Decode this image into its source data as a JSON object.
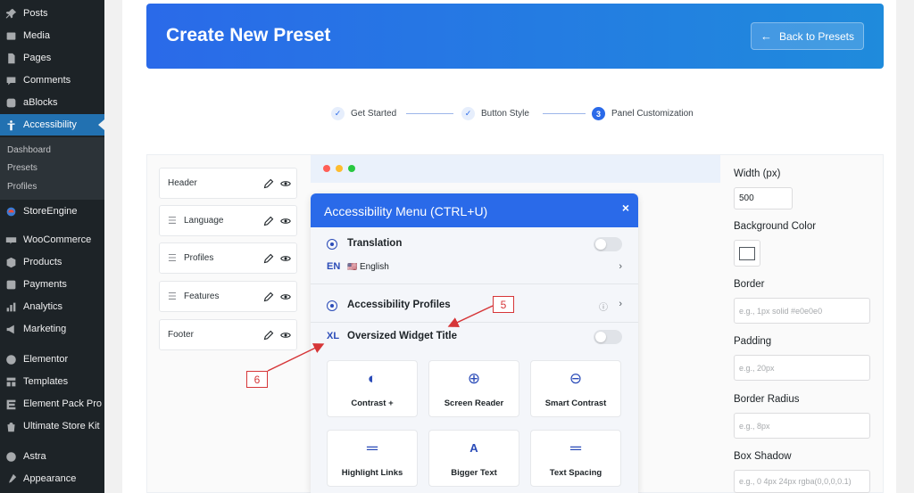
{
  "sidebar": {
    "items": [
      {
        "label": "Posts",
        "icon": "pin-icon"
      },
      {
        "label": "Media",
        "icon": "media-icon"
      },
      {
        "label": "Pages",
        "icon": "pages-icon"
      },
      {
        "label": "Comments",
        "icon": "comments-icon"
      },
      {
        "label": "aBlocks",
        "icon": "ablocks-icon"
      },
      {
        "label": "Accessibility",
        "icon": "accessibility-icon",
        "active": true
      },
      {
        "label": "StoreEngine",
        "icon": "storeengine-icon"
      },
      {
        "label": "WooCommerce",
        "icon": "woocommerce-icon"
      },
      {
        "label": "Products",
        "icon": "products-icon"
      },
      {
        "label": "Payments",
        "icon": "payments-icon"
      },
      {
        "label": "Analytics",
        "icon": "analytics-icon"
      },
      {
        "label": "Marketing",
        "icon": "marketing-icon"
      },
      {
        "label": "Elementor",
        "icon": "elementor-icon"
      },
      {
        "label": "Templates",
        "icon": "templates-icon"
      },
      {
        "label": "Element Pack Pro",
        "icon": "element-pack-icon"
      },
      {
        "label": "Ultimate Store Kit",
        "icon": "store-kit-icon"
      },
      {
        "label": "Astra",
        "icon": "astra-icon"
      },
      {
        "label": "Appearance",
        "icon": "appearance-icon"
      }
    ],
    "submenu": [
      "Dashboard",
      "Presets",
      "Profiles"
    ]
  },
  "header": {
    "title": "Create New Preset",
    "back_label": "Back to Presets"
  },
  "stepper": {
    "steps": [
      {
        "label": "Get Started",
        "state": "done"
      },
      {
        "label": "Button Style",
        "state": "done"
      },
      {
        "label": "Panel Customization",
        "state": "current",
        "number": "3"
      }
    ]
  },
  "sections": [
    "Header",
    "Language",
    "Profiles",
    "Features",
    "Footer"
  ],
  "panel": {
    "title": "Accessibility Menu (CTRL+U)",
    "close": "×",
    "translation_label": "Translation",
    "language_code": "EN",
    "language_flag": "🇺🇸",
    "language_name": "English",
    "profiles_label": "Accessibility Profiles",
    "xl_badge": "XL",
    "widget_title": "Oversized Widget Title",
    "tiles": [
      {
        "label": "Contrast +",
        "icon": "contrast-icon",
        "glyph": "◐"
      },
      {
        "label": "Screen Reader",
        "icon": "screen-reader-icon",
        "glyph": "⊕"
      },
      {
        "label": "Smart Contrast",
        "icon": "smart-contrast-icon",
        "glyph": "⊖"
      },
      {
        "label": "Highlight Links",
        "icon": "highlight-links-icon",
        "glyph": "═"
      },
      {
        "label": "Bigger Text",
        "icon": "bigger-text-icon",
        "glyph": "A"
      },
      {
        "label": "Text Spacing",
        "icon": "text-spacing-icon",
        "glyph": "═"
      }
    ]
  },
  "annotations": {
    "five": "5",
    "six": "6"
  },
  "settings": {
    "width_label": "Width (px)",
    "width_value": "500",
    "bg_label": "Background Color",
    "border_label": "Border",
    "border_placeholder": "e.g., 1px solid #e0e0e0",
    "padding_label": "Padding",
    "padding_placeholder": "e.g., 20px",
    "radius_label": "Border Radius",
    "radius_placeholder": "e.g., 8px",
    "shadow_label": "Box Shadow",
    "shadow_placeholder": "e.g., 0 4px 24px rgba(0,0,0,0.1)"
  },
  "colors": {
    "accent": "#2a6ae9",
    "annotation": "#d63638",
    "sidebar_bg": "#1d2327",
    "sidebar_active": "#2271b1"
  }
}
